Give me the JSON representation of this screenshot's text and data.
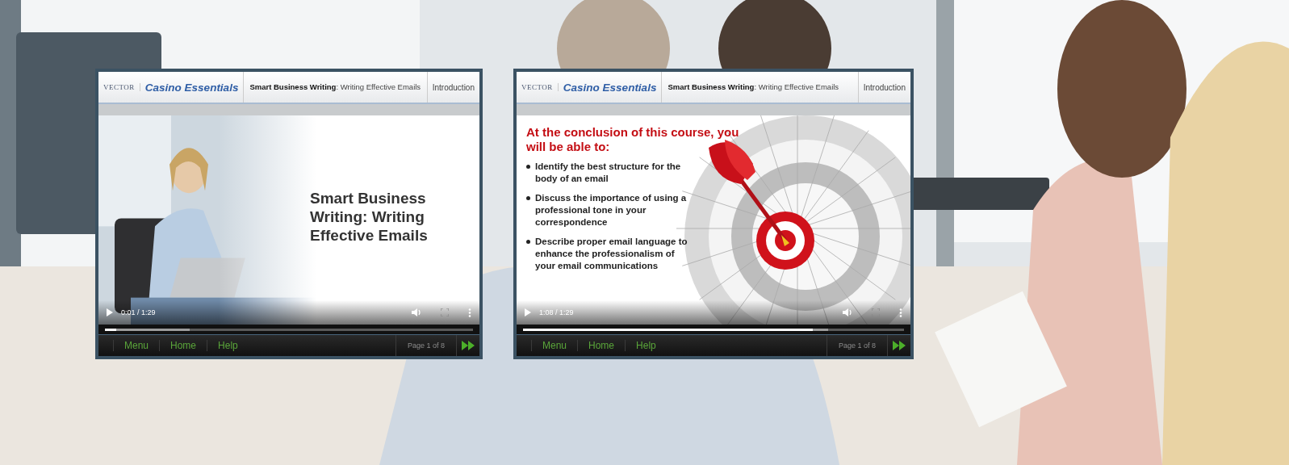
{
  "players": [
    {
      "logo": "VECTOR",
      "brand": "Casino Essentials",
      "course_title": "**Smart Business Writing**: Writing Effective Emails",
      "section": "Introduction",
      "slide": {
        "kind": "title",
        "title": "Smart Business Writing: Writing Effective Emails"
      },
      "time": "0:01 / 1:29",
      "played": {
        "level": 0.03
      },
      "buffered": {
        "level": 0.23
      },
      "nav": [
        "Menu",
        "Home",
        "Help"
      ],
      "page": "Page 1 of 8"
    },
    {
      "logo": "VECTOR",
      "brand": "Casino Essentials",
      "course_title": "**Smart Business Writing**: Writing Effective Emails",
      "section": "Introduction",
      "slide": {
        "kind": "objectives",
        "heading": "At the conclusion of this course, you will be able to:",
        "bullets": [
          "Identify the best structure for the body of an email",
          "Discuss the importance of using a professional tone in your correspondence",
          "Describe proper email language to enhance the professionalism of your email communications"
        ]
      },
      "time": "1:08 / 1:29",
      "played": {
        "level": 0.76
      },
      "buffered": {
        "level": 0.8
      },
      "nav": [
        "Menu",
        "Home",
        "Help"
      ],
      "page": "Page 1 of 8"
    }
  ]
}
